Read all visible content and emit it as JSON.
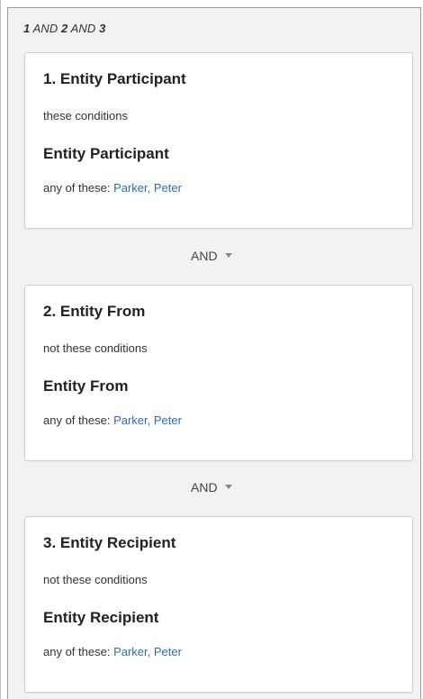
{
  "expression": {
    "parts": [
      "1",
      " AND ",
      "2",
      " AND ",
      "3"
    ]
  },
  "conditions": [
    {
      "title": "1. Entity Participant",
      "mode": "these conditions",
      "field": "Entity Participant",
      "values_prefix": "any of these:",
      "values": "Parker, Peter"
    },
    {
      "title": "2. Entity From",
      "mode": "not these conditions",
      "field": "Entity From",
      "values_prefix": "any of these:",
      "values": "Parker, Peter"
    },
    {
      "title": "3. Entity Recipient",
      "mode": "not these conditions",
      "field": "Entity Recipient",
      "values_prefix": "any of these:",
      "values": "Parker, Peter"
    }
  ],
  "operators": [
    {
      "label": "AND",
      "icon": "caret-down-icon"
    },
    {
      "label": "AND",
      "icon": "caret-down-icon"
    }
  ],
  "colors": {
    "panel_bg": "#f2f2f2",
    "card_bg": "#ffffff",
    "link": "#2a6ebb",
    "border": "#cfcfcf"
  }
}
